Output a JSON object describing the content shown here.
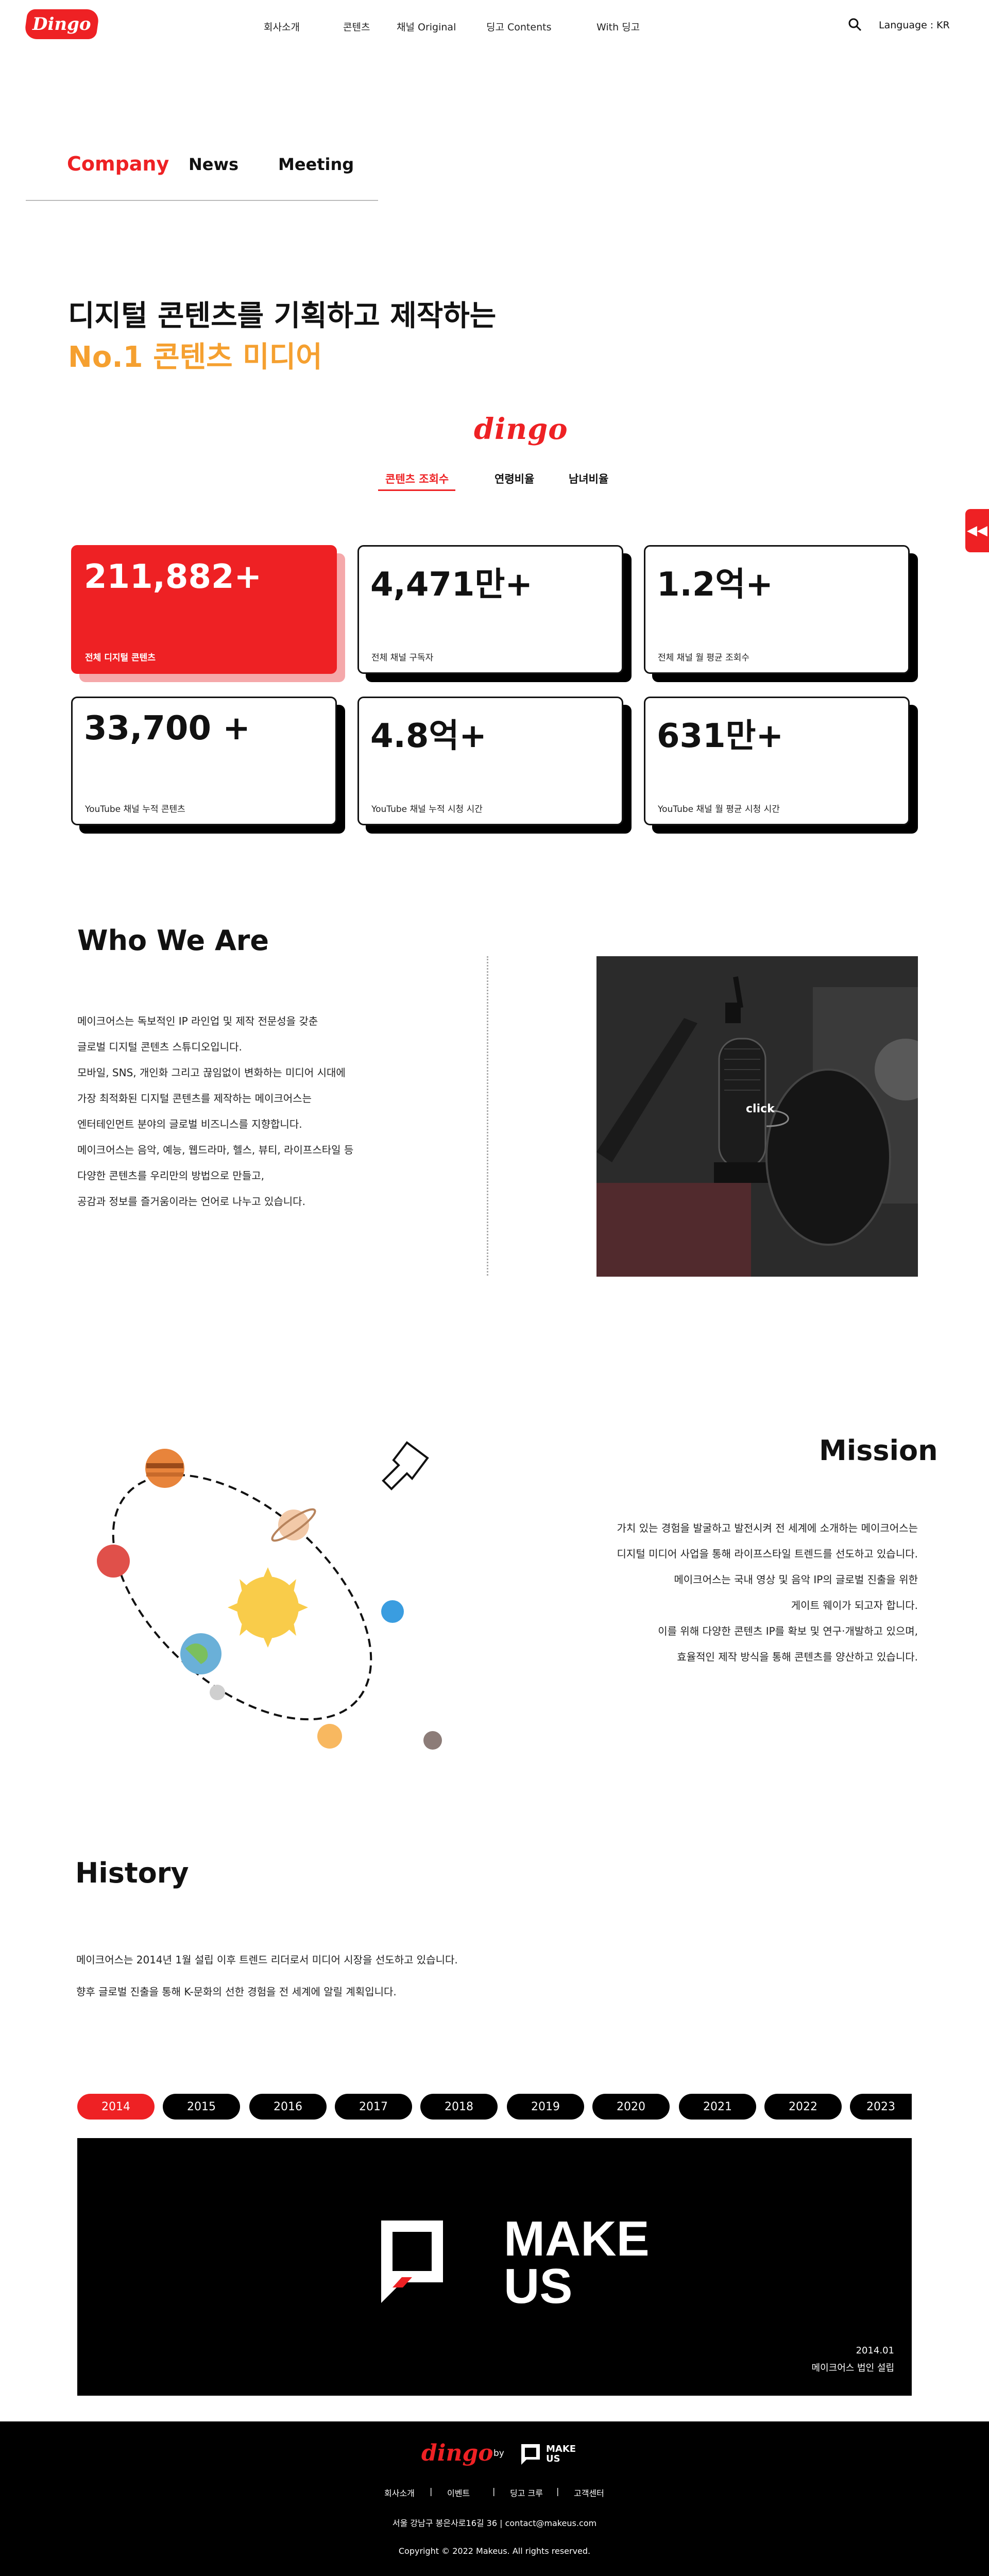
{
  "header": {
    "logo_text": "Dingo",
    "nav": [
      "회사소개",
      "콘텐츠",
      "채널 Original",
      "딩고 Contents",
      "With 딩고"
    ],
    "language_label": "Language :",
    "language_value": "KR"
  },
  "subtabs": [
    "Company",
    "News",
    "Meeting"
  ],
  "headline": {
    "line1": "디지털 콘텐츠를 기획하고 제작하는",
    "line2": "No.1 콘텐츠 미디어"
  },
  "stats": {
    "logo_text": "dingo",
    "tabs": [
      "콘텐츠 조회수",
      "연령비율",
      "남녀비율"
    ],
    "cards": [
      {
        "value": "211,882+",
        "label": "전체 디지털 콘텐츠"
      },
      {
        "value": "4,471만+",
        "label": "전체 채널 구독자"
      },
      {
        "value": "1.2억+",
        "label": "전체 채널 월 평균 조회수"
      },
      {
        "value": "33,700 +",
        "label": "YouTube 채널 누적 콘텐츠"
      },
      {
        "value": "4.8억+",
        "label": "YouTube 채널 누적 시청 시간"
      },
      {
        "value": "631만+",
        "label": "YouTube 채널 월 평균 시청 시간"
      }
    ]
  },
  "who": {
    "title": "Who We Are",
    "lines": [
      "메이크어스는 독보적인 IP 라인업 및 제작 전문성을 갖춘",
      "글로벌 디지털 콘텐츠 스튜디오입니다.",
      "모바일, SNS, 개인화 그리고 끊임없이 변화하는 미디어 시대에",
      "가장 최적화된 디지털 콘텐츠를 제작하는 메이크어스는",
      "엔터테인먼트 분야의 글로벌 비즈니스를 지향합니다.",
      "메이크어스는 음악, 예능, 웹드라마, 헬스, 뷰티, 라이프스타일 등",
      "다양한 콘텐츠를 우리만의 방법으로 만들고,",
      "공감과 정보를 즐거움이라는 언어로 나누고 있습니다."
    ],
    "photo_label": "click"
  },
  "mission": {
    "title": "Mission",
    "lines": [
      "가치 있는 경험을 발굴하고 발전시켜 전 세계에 소개하는 메이크어스는",
      "디지털 미디어 사업을 통해 라이프스타일 트렌드를 선도하고 있습니다.",
      "메이크어스는 국내 영상 및 음악 IP의 글로벌 진출을 위한",
      "게이트 웨이가 되고자 합니다.",
      "이를 위해 다양한 콘텐츠 IP를 확보 및 연구·개발하고 있으며,",
      "효율적인 제작 방식을 통해 콘텐츠를 양산하고 있습니다."
    ]
  },
  "history": {
    "title": "History",
    "lines": [
      "메이크어스는 2014년 1월 설립 이후 트렌드 리더로서 미디어 시장을 선도하고 있습니다.",
      "향후 글로벌 진출을 통해 K-문화의 선한 경험을 전 세계에 알릴 계획입니다."
    ],
    "years": [
      "2014",
      "2015",
      "2016",
      "2017",
      "2018",
      "2019",
      "2020",
      "2021",
      "2022",
      "2023"
    ],
    "active_year": "2014",
    "brand_line1": "MAKE",
    "brand_line2": "US",
    "event_date": "2014.01",
    "event_desc": "메이크어스 법인 설립"
  },
  "footer": {
    "logo_text": "dingo",
    "by": "by",
    "brand_line1": "MAKE",
    "brand_line2": "US",
    "links": [
      "회사소개",
      "이벤트",
      "딩고 크루",
      "고객센터"
    ],
    "separator": "|",
    "address": "서울 강남구 봉은사로16길 36 | contact@makeus.com",
    "copyright": "Copyright © 2022 Makeus. All rights reserved."
  },
  "colors": {
    "accent": "#ee2124",
    "orange": "#f5a030",
    "black": "#000000"
  },
  "icons": {
    "search": "search-icon",
    "side_button": "double-chevron-left-icon"
  }
}
